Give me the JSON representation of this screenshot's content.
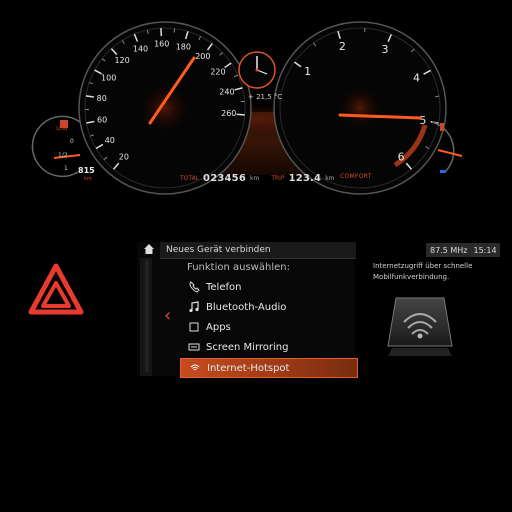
{
  "cluster": {
    "speedo_ticks": [
      "20",
      "40",
      "60",
      "80",
      "100",
      "120",
      "140",
      "160",
      "180",
      "200",
      "220",
      "240",
      "260"
    ],
    "rpm_ticks": [
      "1",
      "2",
      "3",
      "4",
      "5",
      "6"
    ],
    "fuel_ticks": [
      "0",
      "1/2",
      "1"
    ],
    "temp": "+ 21,5 °C",
    "range": "815",
    "range_unit": "km",
    "odo_label": "TOTAL",
    "odometer": "023456",
    "odo_unit": "km",
    "trip_label": "TRIP",
    "trip": "123.4",
    "trip_unit": "km",
    "mode": "COMFORT",
    "colors": {
      "accent": "#e0552a",
      "needle": "#ff5a1f"
    }
  },
  "menu": {
    "title": "Neues Gerät verbinden",
    "subtitle": "Funktion auswählen:",
    "items": [
      {
        "label": "Telefon",
        "icon": "phone-icon"
      },
      {
        "label": "Bluetooth-Audio",
        "icon": "music-note-icon"
      },
      {
        "label": "Apps",
        "icon": "apps-square-icon"
      },
      {
        "label": "Screen Mirroring",
        "icon": "screen-mirroring-icon"
      },
      {
        "label": "Internet-Hotspot",
        "icon": "wifi-hotspot-icon",
        "selected": true
      }
    ]
  },
  "status": {
    "frequency": "87.5 MHz",
    "time": "15:14",
    "info": "Internetzugriff über schnelle Mobilfunkverbindung."
  }
}
